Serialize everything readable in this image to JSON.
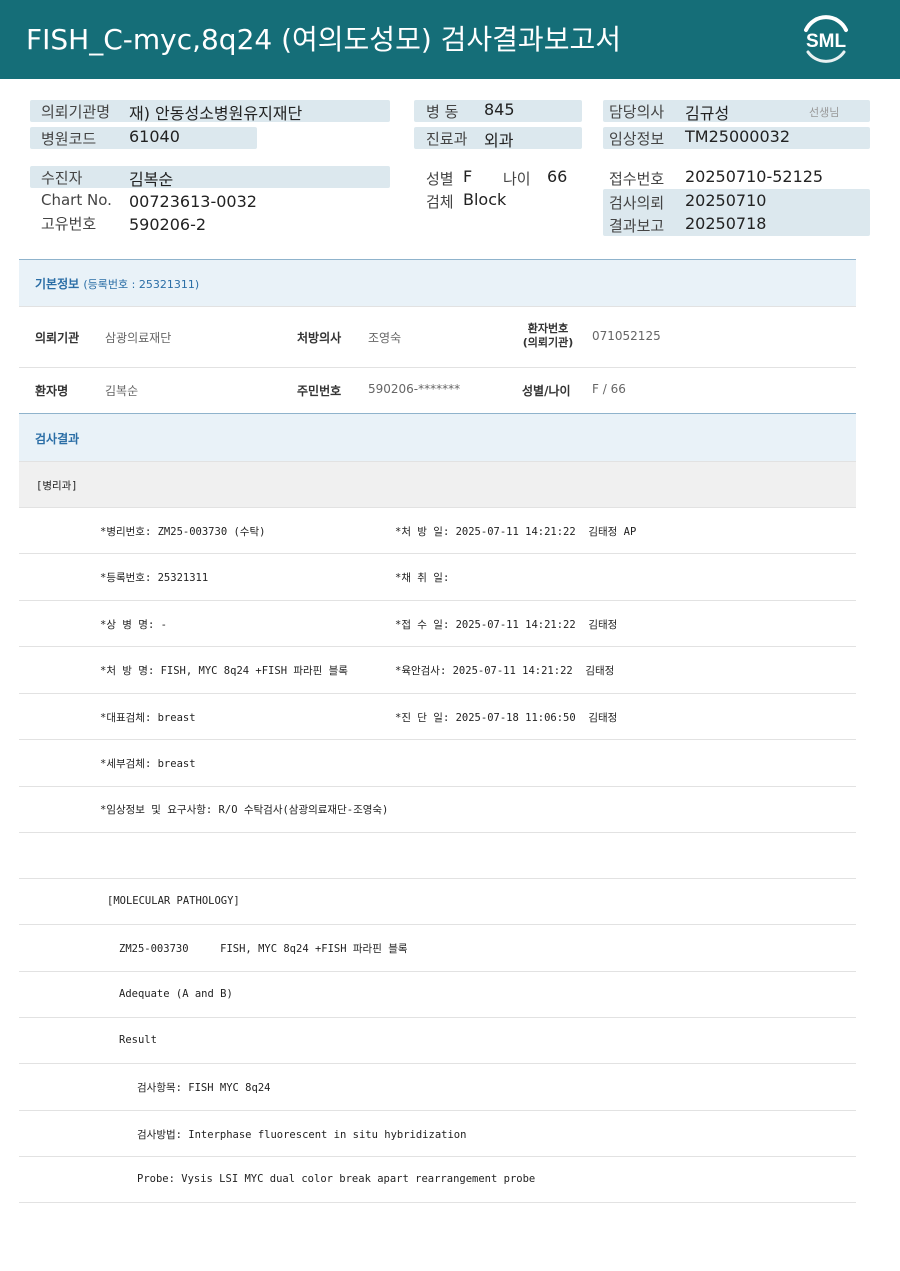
{
  "header": {
    "title": "FISH_C-myc,8q24 (여의도성모) 검사결과보고서",
    "logo_text": "SML"
  },
  "info": {
    "hospital_label": "의뢰기관명",
    "hospital_value": "재) 안동성소병원유지재단",
    "code_label": "병원코드",
    "code_value": "61040",
    "ward_label": "병 동",
    "ward_value": "845",
    "dept_label": "진료과",
    "dept_value": "외과",
    "doctor_label": "담당의사",
    "doctor_value": "김규성",
    "doctor_suffix": "선생님",
    "clinical_label": "임상정보",
    "clinical_value": "TM25000032",
    "patient_label": "수진자",
    "patient_value": "김복순",
    "chart_label": "Chart No.",
    "chart_value": "00723613-0032",
    "id_label": "고유번호",
    "id_value": "590206-2",
    "sex_label": "성별",
    "sex_value": "F",
    "age_label": "나이",
    "age_value": "66",
    "specimen_label": "검체",
    "specimen_value": "Block",
    "receipt_label": "접수번호",
    "receipt_value": "20250710-52125",
    "request_label": "검사의뢰",
    "request_value": "20250710",
    "report_label": "결과보고",
    "report_value": "20250718"
  },
  "basic": {
    "title": "기본정보",
    "reg_label": "(등록번호 : 25321311)",
    "org_label": "의뢰기관",
    "org_value": "삼광의료재단",
    "presc_label": "처방의사",
    "presc_value": "조영숙",
    "pno_label_1": "환자번호",
    "pno_label_2": "(의뢰기관)",
    "pno_value": "071052125",
    "name_label": "환자명",
    "name_value": "김복순",
    "rrn_label": "주민번호",
    "rrn_value": "590206-*******",
    "sexage_label": "성별/나이",
    "sexage_value": "F / 66"
  },
  "result": {
    "title": "검사결과",
    "dept": "[병리과]",
    "rows": [
      {
        "left": "*병리번호: ZM25-003730 (수탁)",
        "right": "*처 방 일: 2025-07-11 14:21:22  김태정 AP"
      },
      {
        "left": "*등록번호: 25321311",
        "right": "*채 취 일:"
      },
      {
        "left": "*상 병 명: -",
        "right": "*접 수 일: 2025-07-11 14:21:22  김태정"
      },
      {
        "left": "*처 방 명: FISH, MYC 8q24 +FISH 파라핀 블록",
        "right": "*육안검사: 2025-07-11 14:21:22  김태정"
      },
      {
        "left": "*대표검체: breast",
        "right": "*진 단 일: 2025-07-18 11:06:50  김태정"
      },
      {
        "left": "*세부검체: breast",
        "right": ""
      },
      {
        "left": "*임상정보 및 요구사항: R/O 수탁검사(삼광의료재단-조영숙)",
        "right": ""
      }
    ],
    "molecular": {
      "title": "[MOLECULAR PATHOLOGY]",
      "line1": "ZM25-003730     FISH, MYC 8q24 +FISH 파라핀 블록",
      "line2": "Adequate (A and B)",
      "line3": "Result",
      "line4": "검사항목: FISH MYC 8q24",
      "line5": "검사방법: Interphase fluorescent in situ hybridization",
      "line6": "Probe: Vysis LSI MYC dual color break apart rearrangement probe"
    }
  }
}
